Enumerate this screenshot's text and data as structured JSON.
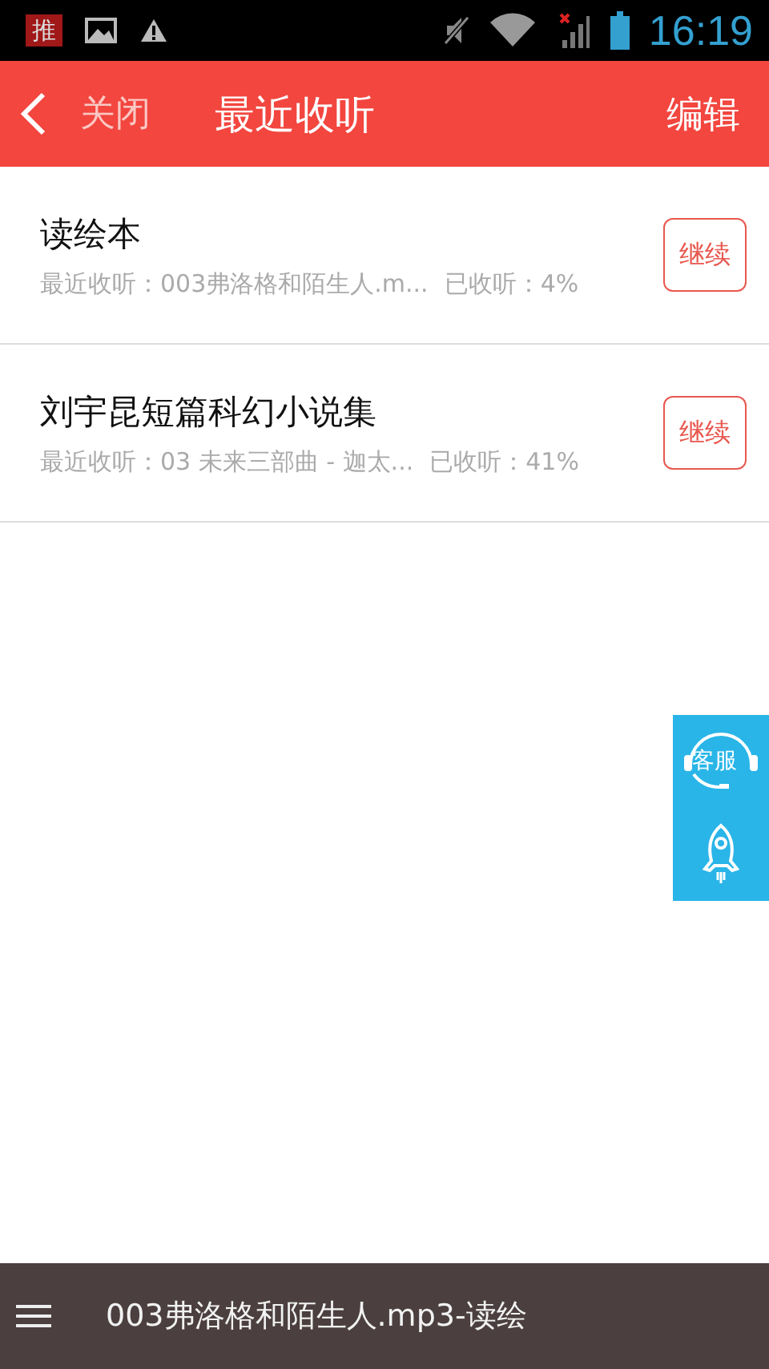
{
  "status_bar": {
    "notification_badge": "推",
    "time": "16:19"
  },
  "header": {
    "back_label": "关闭",
    "title": "最近收听",
    "action": "编辑"
  },
  "items": [
    {
      "title": "读绘本",
      "recent": "最近收听：003弗洛格和陌生人.m...",
      "progress": "已收听：4%",
      "button": "继续"
    },
    {
      "title": "刘宇昆短篇科幻小说集",
      "recent": "最近收听：03 未来三部曲 - 迦太...",
      "progress": "已收听：41%",
      "button": "继续"
    }
  ],
  "float_panel": {
    "service_label": "客服"
  },
  "player": {
    "track": "003弗洛格和陌生人.mp3-读绘"
  }
}
